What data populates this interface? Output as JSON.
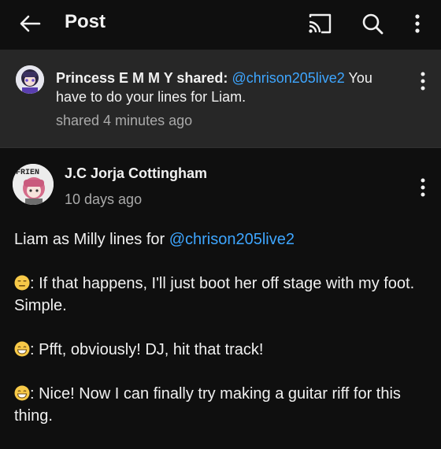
{
  "header": {
    "title": "Post",
    "back_icon": "arrow-left-icon",
    "cast_icon": "cast-icon",
    "search_icon": "search-icon",
    "more_icon": "more-vertical-icon"
  },
  "shared_card": {
    "sharer_name": "Princess E M M Y shared:",
    "mention": "@chrison205live2",
    "message": " You have to do your lines for Liam.",
    "time": "shared 4 minutes ago"
  },
  "post": {
    "author": "J.C Jorja Cottingham",
    "time": "10 days ago",
    "avatar_text": "FRIEN",
    "intro": "Liam as Milly lines for ",
    "intro_mention": "@chrison205live2",
    "lines": [
      {
        "emoji": "expressionless-face",
        "text": ": If that happens, I'll just boot her off stage with my foot. Simple."
      },
      {
        "emoji": "grinning-face",
        "text": ": Pfft, obviously! DJ, hit that track!"
      },
      {
        "emoji": "grinning-face",
        "text": ": Nice! Now I can finally try making a guitar riff for this thing."
      }
    ]
  },
  "colors": {
    "background": "#0f0f0f",
    "card": "#272727",
    "link": "#3ea6ff",
    "secondary_text": "#aaaaaa"
  }
}
